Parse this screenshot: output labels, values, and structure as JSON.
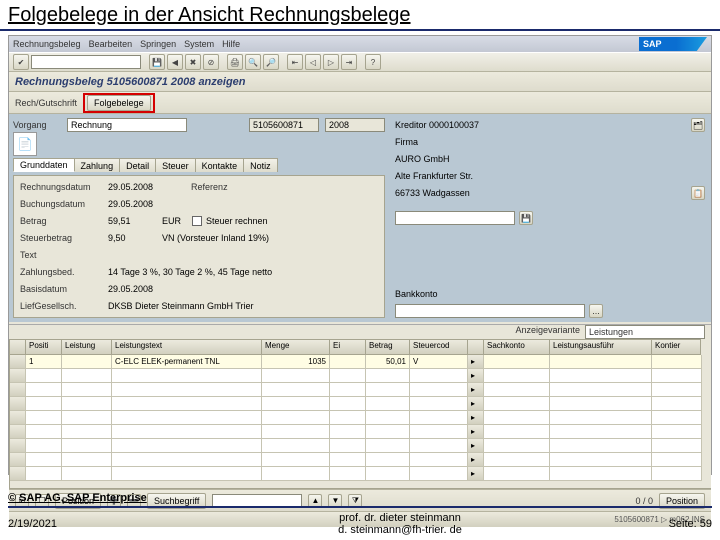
{
  "slide": {
    "title": "Folgebelege in der Ansicht Rechnungsbelege",
    "copyright": "© SAP AG, SAP Enterprise",
    "date": "2/19/2021",
    "author1": "prof. dr. dieter steinmann",
    "author2": "d. steinmann@fh-trier. de",
    "page": "Seite: 59"
  },
  "sap": {
    "logo": "SAP",
    "menu": [
      "Rechnungsbeleg",
      "Bearbeiten",
      "Springen",
      "System",
      "Hilfe"
    ],
    "title": "Rechnungsbeleg 5105600871 2008 anzeigen",
    "row2_label": "Rech/Gutschrift",
    "row2_btn": "Folgebelege",
    "header": {
      "vorgang_label": "Vorgang",
      "vorgang_val": "Rechnung",
      "docnr": "5105600871",
      "year": "2008",
      "page_icon": "📄",
      "tabs": [
        "Grunddaten",
        "Zahlung",
        "Detail",
        "Steuer",
        "Kontakte",
        "Notiz"
      ],
      "rechnungsdatum_l": "Rechnungsdatum",
      "rechnungsdatum": "29.05.2008",
      "referenz_l": "Referenz",
      "buchungsdatum_l": "Buchungsdatum",
      "buchungsdatum": "29.05.2008",
      "betrag_l": "Betrag",
      "betrag": "59,51",
      "waers": "EUR",
      "steuer_cb": "Steuer rechnen",
      "steuerbetrag_l": "Steuerbetrag",
      "steuerbetrag": "9,50",
      "steuerkey": "VN (Vorsteuer Inland 19%)",
      "text_l": "Text",
      "zahlungsbed_l": "Zahlungsbed.",
      "zahlungsbed": "14 Tage 3 %, 30 Tage 2 %, 45 Tage netto",
      "basisdatum_l": "Basisdatum",
      "basisdatum": "29.05.2008",
      "lieferwerk_l": "LiefGesellsch.",
      "lieferwerk": "DKSB Dieter Steinmann GmbH Trier",
      "vendor_l": "Kreditor 0000100037",
      "firma": "Firma",
      "name": "AURO GmbH",
      "street": "Alte Frankfurter Str.",
      "city": "66733 Wadgassen",
      "bank_l": "Bankkonto"
    },
    "anzeigevar_l": "Anzeigevariante",
    "anzeigevar": "Leistungen",
    "grid": {
      "cols": [
        "",
        "Positi",
        "Leistung",
        "Leistungstext",
        "Menge",
        "Ei",
        "Betrag",
        "Steuercod",
        "",
        "Sachkonto",
        "Leistungsausführ",
        "Kontier"
      ],
      "row1": [
        "",
        "1",
        "",
        "C-ELC ELEK-permanent TNL",
        "",
        "",
        "1035",
        "",
        "",
        "50,01",
        "V",
        ""
      ]
    },
    "footer": {
      "positions_l": "Position",
      "suchbegriff_l": "Suchbegriff",
      "pos_nav": "0 / 0",
      "pos_btn": "Position"
    },
    "status": "5105600871  ▷  m062  INS"
  }
}
